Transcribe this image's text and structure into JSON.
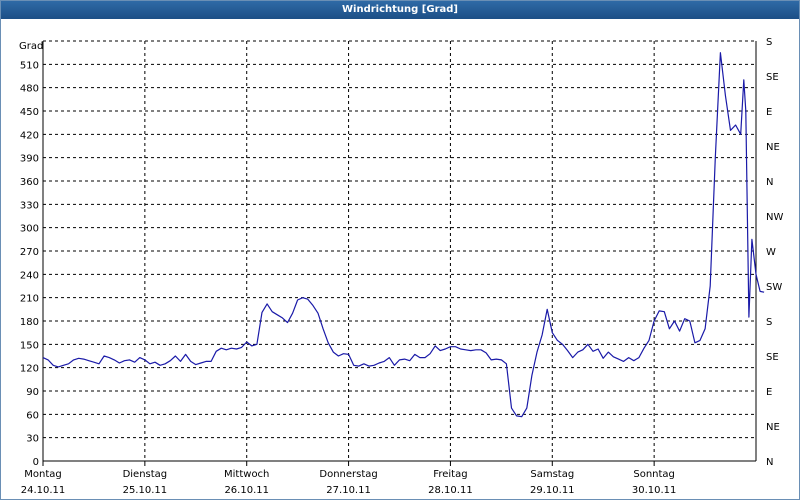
{
  "window": {
    "title": "Windrichtung [Grad]"
  },
  "colors": {
    "line": "#1a1aa8",
    "grid": "#000000",
    "titlebar": "#1d4f86"
  },
  "chart_data": {
    "type": "line",
    "title": "Windrichtung [Grad]",
    "ylabel": "Grad",
    "ylim": [
      0,
      540
    ],
    "yticks": [
      0,
      30,
      60,
      90,
      120,
      150,
      180,
      210,
      240,
      270,
      300,
      330,
      360,
      390,
      420,
      450,
      480,
      510
    ],
    "right_axis_labels": [
      "N",
      "NE",
      "E",
      "SE",
      "S",
      "SW",
      "W",
      "NW",
      "N",
      "NE",
      "E",
      "SE",
      "S"
    ],
    "xlim": [
      0,
      7
    ],
    "x_categories": [
      {
        "day": "Montag",
        "date": "24.10.11"
      },
      {
        "day": "Dienstag",
        "date": "25.10.11"
      },
      {
        "day": "Mittwoch",
        "date": "26.10.11"
      },
      {
        "day": "Donnerstag",
        "date": "27.10.11"
      },
      {
        "day": "Freitag",
        "date": "28.10.11"
      },
      {
        "day": "Samstag",
        "date": "29.10.11"
      },
      {
        "day": "Sonntag",
        "date": "30.10.11"
      }
    ],
    "grid": true,
    "series": [
      {
        "values": [
          [
            0.0,
            133
          ],
          [
            0.05,
            130
          ],
          [
            0.1,
            123
          ],
          [
            0.15,
            121
          ],
          [
            0.2,
            123
          ],
          [
            0.25,
            125
          ],
          [
            0.3,
            130
          ],
          [
            0.35,
            132
          ],
          [
            0.4,
            131
          ],
          [
            0.45,
            129
          ],
          [
            0.5,
            127
          ],
          [
            0.55,
            125
          ],
          [
            0.6,
            135
          ],
          [
            0.65,
            133
          ],
          [
            0.7,
            130
          ],
          [
            0.75,
            126
          ],
          [
            0.8,
            129
          ],
          [
            0.85,
            130
          ],
          [
            0.9,
            127
          ],
          [
            0.95,
            133
          ],
          [
            1.0,
            130
          ],
          [
            1.05,
            125
          ],
          [
            1.1,
            127
          ],
          [
            1.15,
            123
          ],
          [
            1.2,
            125
          ],
          [
            1.25,
            129
          ],
          [
            1.3,
            135
          ],
          [
            1.35,
            128
          ],
          [
            1.4,
            137
          ],
          [
            1.45,
            128
          ],
          [
            1.5,
            124
          ],
          [
            1.55,
            126
          ],
          [
            1.6,
            128
          ],
          [
            1.65,
            128
          ],
          [
            1.7,
            141
          ],
          [
            1.75,
            145
          ],
          [
            1.8,
            143
          ],
          [
            1.85,
            145
          ],
          [
            1.9,
            144
          ],
          [
            1.95,
            146
          ],
          [
            2.0,
            153
          ],
          [
            2.05,
            148
          ],
          [
            2.1,
            150
          ],
          [
            2.15,
            191
          ],
          [
            2.2,
            202
          ],
          [
            2.25,
            192
          ],
          [
            2.3,
            188
          ],
          [
            2.35,
            184
          ],
          [
            2.4,
            178
          ],
          [
            2.45,
            190
          ],
          [
            2.5,
            207
          ],
          [
            2.55,
            210
          ],
          [
            2.6,
            208
          ],
          [
            2.65,
            200
          ],
          [
            2.7,
            190
          ],
          [
            2.75,
            170
          ],
          [
            2.8,
            152
          ],
          [
            2.85,
            140
          ],
          [
            2.9,
            135
          ],
          [
            2.95,
            138
          ],
          [
            3.0,
            137
          ],
          [
            3.05,
            123
          ],
          [
            3.1,
            122
          ],
          [
            3.15,
            125
          ],
          [
            3.2,
            122
          ],
          [
            3.25,
            123
          ],
          [
            3.3,
            126
          ],
          [
            3.35,
            128
          ],
          [
            3.4,
            133
          ],
          [
            3.45,
            123
          ],
          [
            3.5,
            130
          ],
          [
            3.55,
            131
          ],
          [
            3.6,
            129
          ],
          [
            3.65,
            137
          ],
          [
            3.7,
            133
          ],
          [
            3.75,
            133
          ],
          [
            3.8,
            138
          ],
          [
            3.85,
            148
          ],
          [
            3.9,
            142
          ],
          [
            3.95,
            144
          ],
          [
            4.0,
            147
          ],
          [
            4.05,
            147
          ],
          [
            4.1,
            144
          ],
          [
            4.15,
            143
          ],
          [
            4.2,
            142
          ],
          [
            4.25,
            143
          ],
          [
            4.3,
            143
          ],
          [
            4.35,
            139
          ],
          [
            4.4,
            130
          ],
          [
            4.45,
            131
          ],
          [
            4.5,
            130
          ],
          [
            4.55,
            125
          ],
          [
            4.6,
            68
          ],
          [
            4.65,
            58
          ],
          [
            4.7,
            57
          ],
          [
            4.75,
            68
          ],
          [
            4.8,
            110
          ],
          [
            4.85,
            140
          ],
          [
            4.9,
            162
          ],
          [
            4.95,
            195
          ],
          [
            5.0,
            165
          ],
          [
            5.05,
            155
          ],
          [
            5.1,
            150
          ],
          [
            5.15,
            142
          ],
          [
            5.2,
            133
          ],
          [
            5.25,
            140
          ],
          [
            5.3,
            143
          ],
          [
            5.35,
            150
          ],
          [
            5.4,
            141
          ],
          [
            5.45,
            144
          ],
          [
            5.5,
            132
          ],
          [
            5.55,
            140
          ],
          [
            5.6,
            134
          ],
          [
            5.65,
            131
          ],
          [
            5.7,
            128
          ],
          [
            5.75,
            133
          ],
          [
            5.8,
            129
          ],
          [
            5.85,
            133
          ],
          [
            5.9,
            145
          ],
          [
            5.95,
            155
          ],
          [
            6.0,
            180
          ],
          [
            6.05,
            193
          ],
          [
            6.1,
            192
          ],
          [
            6.15,
            170
          ],
          [
            6.2,
            180
          ],
          [
            6.25,
            167
          ],
          [
            6.3,
            183
          ],
          [
            6.35,
            180
          ],
          [
            6.4,
            152
          ],
          [
            6.45,
            155
          ],
          [
            6.5,
            170
          ],
          [
            6.55,
            225
          ],
          [
            6.6,
            390
          ],
          [
            6.65,
            525
          ],
          [
            6.7,
            470
          ],
          [
            6.75,
            425
          ],
          [
            6.8,
            432
          ],
          [
            6.85,
            420
          ],
          [
            6.88,
            490
          ],
          [
            6.9,
            450
          ],
          [
            6.93,
            185
          ],
          [
            6.96,
            285
          ],
          [
            7.0,
            240
          ],
          [
            7.04,
            218
          ],
          [
            7.08,
            217
          ]
        ]
      }
    ]
  }
}
